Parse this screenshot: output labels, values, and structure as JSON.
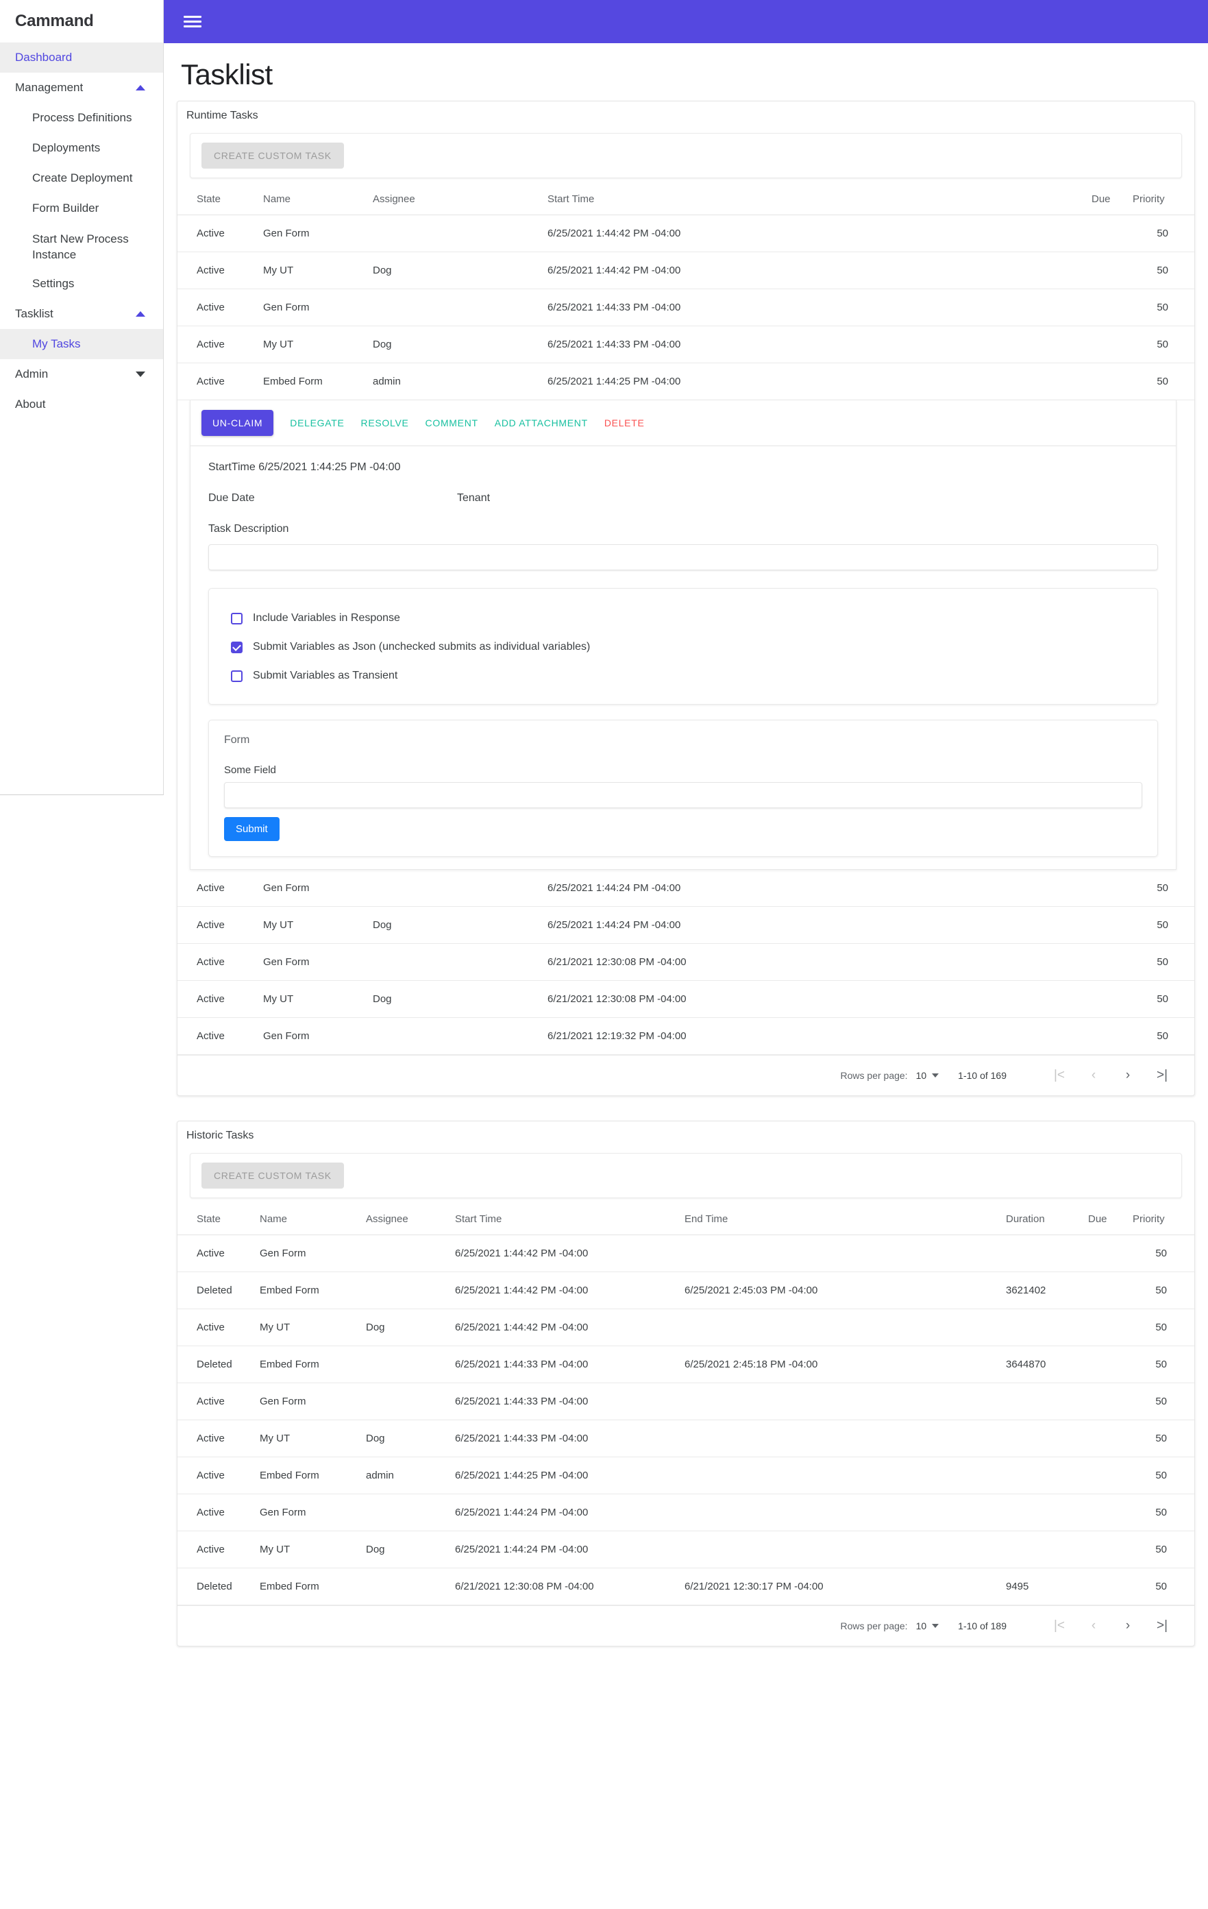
{
  "app": {
    "brand": "Cammand",
    "menu_icon": "hamburger-icon"
  },
  "sidebar": {
    "dashboard": "Dashboard",
    "management": {
      "label": "Management",
      "items": [
        "Process Definitions",
        "Deployments",
        "Create Deployment",
        "Form Builder",
        "Start New Process Instance",
        "Settings"
      ]
    },
    "tasklist": {
      "label": "Tasklist",
      "items": [
        "My Tasks"
      ]
    },
    "admin": "Admin",
    "about": "About"
  },
  "page": {
    "title": "Tasklist"
  },
  "runtime": {
    "section_label": "Runtime Tasks",
    "create_button": "CREATE CUSTOM TASK",
    "columns": [
      "State",
      "Name",
      "Assignee",
      "Start Time",
      "Due",
      "Priority"
    ],
    "rows_before": [
      {
        "state": "Active",
        "name": "Gen Form",
        "assignee": "",
        "start": "6/25/2021 1:44:42 PM -04:00",
        "due": "",
        "priority": "50"
      },
      {
        "state": "Active",
        "name": "My UT",
        "assignee": "Dog",
        "start": "6/25/2021 1:44:42 PM -04:00",
        "due": "",
        "priority": "50"
      },
      {
        "state": "Active",
        "name": "Gen Form",
        "assignee": "",
        "start": "6/25/2021 1:44:33 PM -04:00",
        "due": "",
        "priority": "50"
      },
      {
        "state": "Active",
        "name": "My UT",
        "assignee": "Dog",
        "start": "6/25/2021 1:44:33 PM -04:00",
        "due": "",
        "priority": "50"
      },
      {
        "state": "Active",
        "name": "Embed Form",
        "assignee": "admin",
        "start": "6/25/2021 1:44:25 PM -04:00",
        "due": "",
        "priority": "50"
      }
    ],
    "rows_after": [
      {
        "state": "Active",
        "name": "Gen Form",
        "assignee": "",
        "start": "6/25/2021 1:44:24 PM -04:00",
        "due": "",
        "priority": "50"
      },
      {
        "state": "Active",
        "name": "My UT",
        "assignee": "Dog",
        "start": "6/25/2021 1:44:24 PM -04:00",
        "due": "",
        "priority": "50"
      },
      {
        "state": "Active",
        "name": "Gen Form",
        "assignee": "",
        "start": "6/21/2021 12:30:08 PM -04:00",
        "due": "",
        "priority": "50"
      },
      {
        "state": "Active",
        "name": "My UT",
        "assignee": "Dog",
        "start": "6/21/2021 12:30:08 PM -04:00",
        "due": "",
        "priority": "50"
      },
      {
        "state": "Active",
        "name": "Gen Form",
        "assignee": "",
        "start": "6/21/2021 12:19:32 PM -04:00",
        "due": "",
        "priority": "50"
      }
    ],
    "pager": {
      "rows_per_page_label": "Rows per page:",
      "rows_per_page_value": "10",
      "range": "1-10 of 169",
      "first": "|<",
      "prev": "‹",
      "next": "›",
      "last": ">|"
    }
  },
  "detail": {
    "actions": {
      "unclaim": "UN-CLAIM",
      "delegate": "DELEGATE",
      "resolve": "RESOLVE",
      "comment": "COMMENT",
      "add_attachment": "ADD ATTACHMENT",
      "delete": "DELETE"
    },
    "start_time": "StartTime 6/25/2021 1:44:25 PM -04:00",
    "due_date_label": "Due Date",
    "tenant_label": "Tenant",
    "task_description_label": "Task Description",
    "task_description_value": "",
    "options": [
      {
        "label": "Include Variables in Response",
        "checked": false
      },
      {
        "label": "Submit Variables as Json (unchecked submits as individual variables)",
        "checked": true
      },
      {
        "label": "Submit Variables as Transient",
        "checked": false
      }
    ],
    "form": {
      "title": "Form",
      "field_label": "Some Field",
      "field_value": "",
      "submit": "Submit"
    }
  },
  "historic": {
    "section_label": "Historic Tasks",
    "create_button": "CREATE CUSTOM TASK",
    "columns": [
      "State",
      "Name",
      "Assignee",
      "Start Time",
      "End Time",
      "Duration",
      "Due",
      "Priority"
    ],
    "rows": [
      {
        "state": "Active",
        "name": "Gen Form",
        "assignee": "",
        "start": "6/25/2021 1:44:42 PM -04:00",
        "end": "",
        "duration": "",
        "due": "",
        "priority": "50"
      },
      {
        "state": "Deleted",
        "name": "Embed Form",
        "assignee": "",
        "start": "6/25/2021 1:44:42 PM -04:00",
        "end": "6/25/2021 2:45:03 PM -04:00",
        "duration": "3621402",
        "due": "",
        "priority": "50"
      },
      {
        "state": "Active",
        "name": "My UT",
        "assignee": "Dog",
        "start": "6/25/2021 1:44:42 PM -04:00",
        "end": "",
        "duration": "",
        "due": "",
        "priority": "50"
      },
      {
        "state": "Deleted",
        "name": "Embed Form",
        "assignee": "",
        "start": "6/25/2021 1:44:33 PM -04:00",
        "end": "6/25/2021 2:45:18 PM -04:00",
        "duration": "3644870",
        "due": "",
        "priority": "50"
      },
      {
        "state": "Active",
        "name": "Gen Form",
        "assignee": "",
        "start": "6/25/2021 1:44:33 PM -04:00",
        "end": "",
        "duration": "",
        "due": "",
        "priority": "50"
      },
      {
        "state": "Active",
        "name": "My UT",
        "assignee": "Dog",
        "start": "6/25/2021 1:44:33 PM -04:00",
        "end": "",
        "duration": "",
        "due": "",
        "priority": "50"
      },
      {
        "state": "Active",
        "name": "Embed Form",
        "assignee": "admin",
        "start": "6/25/2021 1:44:25 PM -04:00",
        "end": "",
        "duration": "",
        "due": "",
        "priority": "50"
      },
      {
        "state": "Active",
        "name": "Gen Form",
        "assignee": "",
        "start": "6/25/2021 1:44:24 PM -04:00",
        "end": "",
        "duration": "",
        "due": "",
        "priority": "50"
      },
      {
        "state": "Active",
        "name": "My UT",
        "assignee": "Dog",
        "start": "6/25/2021 1:44:24 PM -04:00",
        "end": "",
        "duration": "",
        "due": "",
        "priority": "50"
      },
      {
        "state": "Deleted",
        "name": "Embed Form",
        "assignee": "",
        "start": "6/21/2021 12:30:08 PM -04:00",
        "end": "6/21/2021 12:30:17 PM -04:00",
        "duration": "9495",
        "due": "",
        "priority": "50"
      }
    ],
    "pager": {
      "rows_per_page_label": "Rows per page:",
      "rows_per_page_value": "10",
      "range": "1-10 of 189",
      "first": "|<",
      "prev": "‹",
      "next": "›",
      "last": ">|"
    }
  },
  "colors": {
    "primary": "#5548e0",
    "accent_teal": "#18c0a0",
    "danger": "#fa5252",
    "submit_blue": "#157ffb"
  }
}
